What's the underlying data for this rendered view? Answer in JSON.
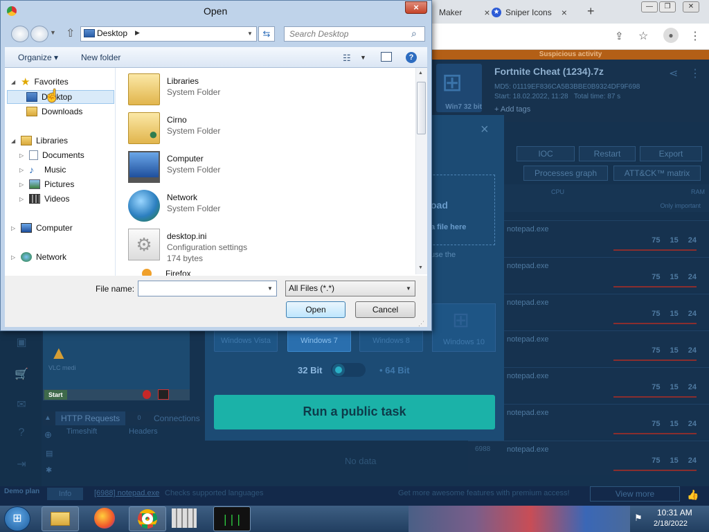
{
  "chrome": {
    "tabs": [
      {
        "label": "Maker"
      },
      {
        "label": "Sniper Icons"
      }
    ],
    "new_tab": "+",
    "close_glyph": "×"
  },
  "app": {
    "warning": "Suspicious activity",
    "task_title": "Fortnite Cheat (1234).7z",
    "md5": "MD5: 01119EF836CA5B3BBE0B9324DF9F698",
    "start": "Start: 18.02.2022, 11:28",
    "total_time": "Total time: 87 s",
    "add_tags": "+ Add tags",
    "thumb_label": "Win7 32 bit",
    "tabs": [
      "IOC",
      "Restart",
      "Export"
    ],
    "views": [
      "Processes graph",
      "ATT&CK™ matrix"
    ],
    "proc_col_cpu": "CPU",
    "proc_col_ram": "RAM",
    "proc_only_important": "Only important",
    "process_rows": [
      {
        "pid": "",
        "name": "notepad.exe",
        "a": "75",
        "b": "15",
        "c": "24"
      },
      {
        "pid": "",
        "name": "notepad.exe",
        "a": "75",
        "b": "15",
        "c": "24"
      },
      {
        "pid": "",
        "name": "notepad.exe",
        "a": "75",
        "b": "15",
        "c": "24"
      },
      {
        "pid": "",
        "name": "notepad.exe",
        "a": "75",
        "b": "15",
        "c": "24"
      },
      {
        "pid": "",
        "name": "notepad.exe",
        "a": "75",
        "b": "15",
        "c": "24"
      },
      {
        "pid": "",
        "name": "notepad.exe",
        "a": "75",
        "b": "15",
        "c": "24"
      },
      {
        "pid": "6988",
        "name": "notepad.exe",
        "a": "75",
        "b": "15",
        "c": "24"
      }
    ],
    "modal": {
      "drop_title": "oad",
      "drop_sub": "a file here",
      "drop_hint": "use the",
      "os_options": [
        "Windows Vista",
        "Windows 7",
        "Windows 8",
        "Windows 10"
      ],
      "bit32": "32 Bit",
      "bit64": "• 64 Bit",
      "run_button": "Run a public task",
      "close": "×"
    },
    "vm": {
      "icon_label": "VLC media player",
      "start": "Start"
    },
    "network": {
      "tab_http": "HTTP Requests",
      "http_count": "0",
      "tab_connections": "Connections",
      "col_timeshift": "Timeshift",
      "col_headers": "Headers",
      "empty": "No data"
    },
    "status": {
      "plan": "Demo plan",
      "info_tab": "Info",
      "process": "[6988] notepad.exe",
      "message": "Checks supported languages",
      "premium": "Get more awesome features with premium access!",
      "view_more": "View more"
    }
  },
  "dialog": {
    "title": "Open",
    "close": "×",
    "address": "Desktop",
    "search_placeholder": "Search Desktop",
    "organize": "Organize ▾",
    "new_folder": "New folder",
    "help": "?",
    "nav_tree": [
      {
        "label": "Favorites",
        "level": 0
      },
      {
        "label": "Desktop",
        "level": 1
      },
      {
        "label": "Downloads",
        "level": 1
      },
      {
        "label": "Libraries",
        "level": 0
      },
      {
        "label": "Documents",
        "level": 1
      },
      {
        "label": "Music",
        "level": 1
      },
      {
        "label": "Pictures",
        "level": 1
      },
      {
        "label": "Videos",
        "level": 1
      },
      {
        "label": "Computer",
        "level": 0
      },
      {
        "label": "Network",
        "level": 0
      }
    ],
    "files": [
      {
        "name": "Libraries",
        "desc": "System Folder",
        "extra": ""
      },
      {
        "name": "Cirno",
        "desc": "System Folder",
        "extra": ""
      },
      {
        "name": "Computer",
        "desc": "System Folder",
        "extra": ""
      },
      {
        "name": "Network",
        "desc": "System Folder",
        "extra": ""
      },
      {
        "name": "desktop.ini",
        "desc": "Configuration settings",
        "extra": "174 bytes"
      },
      {
        "name": "Firefox",
        "desc": "",
        "extra": ""
      }
    ],
    "file_name_label": "File name:",
    "file_name_value": "",
    "file_type": "All Files (*.*)",
    "open_button": "Open",
    "cancel_button": "Cancel"
  },
  "taskbar": {
    "time": "10:31 AM",
    "date": "2/18/2022"
  }
}
